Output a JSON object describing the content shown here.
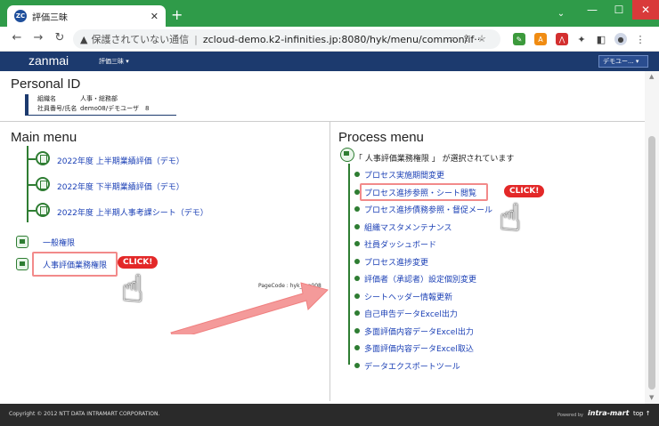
{
  "browser": {
    "tab_title": "評価三昧",
    "favicon_text": "ZC",
    "new_tab": "+",
    "insecure_label": "保護されていない通信",
    "url": "zcloud-demo.k2-infinities.jp:8080/hyk/menu/common/if···",
    "window_min": "—",
    "window_max": "☐",
    "window_close": "✕"
  },
  "app": {
    "brand": "zanmai",
    "menu_dropdown": "評価三昧 ▾",
    "demo_select": "デモユー... ▾"
  },
  "personal_id": {
    "title": "Personal ID",
    "org_label": "組織名",
    "org_value": "人事・総務部",
    "emp_label": "社員番号/氏名",
    "emp_value": "demo08/デモユーザ　8"
  },
  "main_menu": {
    "title": "Main menu",
    "items": [
      {
        "label": "2022年度 上半期業績評価（デモ）"
      },
      {
        "label": "2022年度 下半期業績評価（デモ）"
      },
      {
        "label": "2022年度 上半期人事考課シート（デモ）"
      }
    ],
    "roles": [
      {
        "label": "一般権限"
      },
      {
        "label": "人事評価業務権限"
      }
    ],
    "page_code": "PageCode : hyk_top008"
  },
  "process_menu": {
    "title": "Process menu",
    "selected_text": "「 人事評価業務権限 」 が選択されています",
    "items": [
      {
        "label": "プロセス実施期間変更"
      },
      {
        "label": "プロセス進捗参照・シート閲覧"
      },
      {
        "label": "プロセス進捗債務参照・督促メール"
      },
      {
        "label": "組織マスタメンテナンス"
      },
      {
        "label": "社員ダッシュボード"
      },
      {
        "label": "プロセス進捗変更"
      },
      {
        "label": "評価者（承認者）設定個別変更"
      },
      {
        "label": "シートヘッダー情報更新"
      },
      {
        "label": "自己申告データExcel出力"
      },
      {
        "label": "多面評価内容データExcel出力"
      },
      {
        "label": "多面評価内容データExcel取込"
      },
      {
        "label": "データエクスポートツール"
      }
    ]
  },
  "annotations": {
    "click_label": "CLICK!"
  },
  "footer": {
    "copyright": "Copyright © 2012 NTT DATA INTRAMART CORPORATION.",
    "powered": "Powered by",
    "brand": "intra-mart",
    "top": "top ↑"
  },
  "colors": {
    "chrome_green": "#2f9b49",
    "app_header": "#1c3a6e",
    "tree_green": "#2e7d32",
    "link_blue": "#1a3fb5",
    "highlight_pink": "#f28a8a",
    "click_red": "#e32828"
  }
}
